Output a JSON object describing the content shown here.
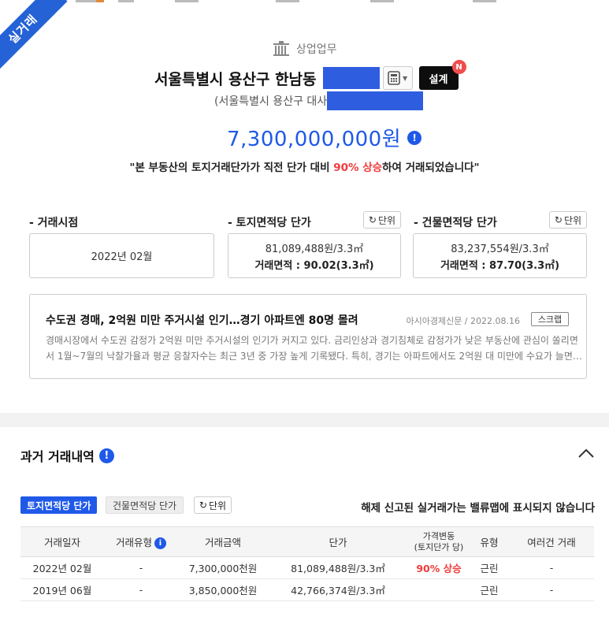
{
  "ribbon": {
    "label": "실거래"
  },
  "header": {
    "category": "상업업무",
    "address": "서울특별시 용산구 한남동",
    "sub_address": "(서울특별시 용산구 대사",
    "design_button": "설계",
    "new_badge": "N",
    "price": "7,300,000,000원",
    "quote_prefix": "\"본 부동산의 토지거래단가가 직전 단가 대비",
    "quote_highlight": "90% 상승",
    "quote_suffix": "하여 거래되었습니다\""
  },
  "info_columns": [
    {
      "title": "- 거래시점",
      "line1": "2022년 02월",
      "line2": ""
    },
    {
      "title": "- 토지면적당 단가",
      "unit_button": "단위",
      "line1": "81,089,488원/3.3㎡",
      "line2": "거래면적 : 90.02(3.3㎡)"
    },
    {
      "title": "- 건물면적당 단가",
      "unit_button": "단위",
      "line1": "83,237,554원/3.3㎡",
      "line2": "거래면적 : 87.70(3.3㎡)"
    }
  ],
  "news": {
    "title": "수도권 경매, 2억원 미만 주거시설 인기…경기 아파트엔 80명 몰려",
    "source": "아시아경제신문 / 2022.08.16",
    "scrap_button": "스크랩",
    "body_line1": "경매시장에서 수도권 감정가 2억원 미만 주거시설의 인기가 커지고 있다. 금리인상과 경기침체로 감정가가 낮은 부동산에 관심이 쏠리면",
    "body_line2": "서 1월~7월의 낙찰가율과 평균 응찰자수는 최근 3년 중 가장 높게 기록됐다. 특히, 경기는 아파트에서도 2억원 대 미만에 수요가 늘면…"
  },
  "history": {
    "title": "과거 거래내역",
    "tab_land": "토지면적당 단가",
    "tab_building": "건물면적당 단가",
    "unit_button": "단위",
    "notice": "해제 신고된 실거래가는 밸류맵에 표시되지 않습니다",
    "columns": [
      "거래일자",
      "거래유형",
      "거래금액",
      "단가",
      "가격변동",
      "(토지단가 당)",
      "유형",
      "여러건 거래"
    ],
    "rows": [
      {
        "date": "2022년 02월",
        "type": "-",
        "amount": "7,300,000천원",
        "unit_price": "81,089,488원/3.3㎡",
        "change": "90% 상승",
        "kind": "근린",
        "multi": "-"
      },
      {
        "date": "2019년 06월",
        "type": "-",
        "amount": "3,850,000천원",
        "unit_price": "42,766,374원/3.3㎡",
        "change": "",
        "kind": "근린",
        "multi": "-"
      }
    ]
  },
  "colors": {
    "accent": "#1f59e8",
    "ribbon": "#2462d6",
    "highlight": "#f03c3c",
    "redaction": "#2f5de0"
  }
}
